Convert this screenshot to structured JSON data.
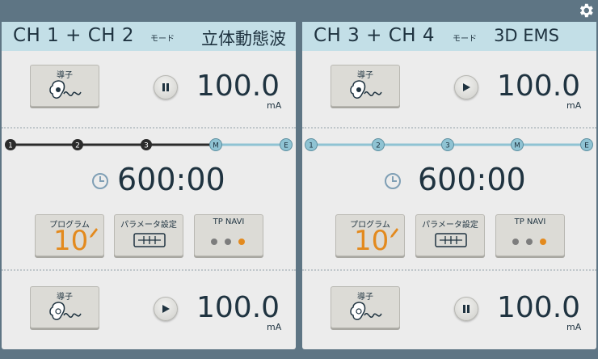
{
  "settings_icon": "gear-icon",
  "panels": [
    {
      "title": "CH 1 + CH 2",
      "mode_label": "モード",
      "mode_value": "立体動態波",
      "top": {
        "probe_label": "導子",
        "state": "paused",
        "value": "100.0",
        "unit": "mA"
      },
      "progress": {
        "markers": [
          "1",
          "2",
          "3",
          "M",
          "E"
        ],
        "active_upto": 3
      },
      "timer": "600:00",
      "program": {
        "label": "プログラム",
        "number": "10"
      },
      "param": {
        "label": "パラメータ設定"
      },
      "navi": {
        "label": "TP NAVI"
      },
      "bottom": {
        "probe_label": "導子",
        "state": "playing",
        "value": "100.0",
        "unit": "mA"
      }
    },
    {
      "title": "CH 3 + CH 4",
      "mode_label": "モード",
      "mode_value": "3D EMS",
      "top": {
        "probe_label": "導子",
        "state": "playing",
        "value": "100.0",
        "unit": "mA"
      },
      "progress": {
        "markers": [
          "1",
          "2",
          "3",
          "M",
          "E"
        ],
        "active_upto": 0
      },
      "timer": "600:00",
      "program": {
        "label": "プログラム",
        "number": "10"
      },
      "param": {
        "label": "パラメータ設定"
      },
      "navi": {
        "label": "TP NAVI"
      },
      "bottom": {
        "probe_label": "導子",
        "state": "paused",
        "value": "100.0",
        "unit": "mA"
      }
    }
  ],
  "colors": {
    "header_bg": "#c3dfe7",
    "accent_orange": "#e38a1e",
    "progress_done": "#2b2b2b",
    "progress_todo": "#8fc3d3",
    "text_dark": "#1f3340"
  }
}
